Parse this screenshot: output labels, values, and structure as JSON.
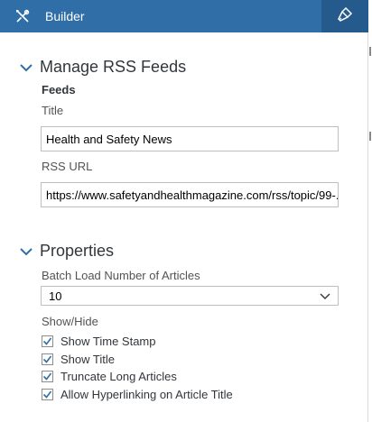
{
  "header": {
    "title": "Builder",
    "tools_icon": "tools-icon",
    "brush_icon": "paintbrush-icon"
  },
  "feeds_section": {
    "title": "Manage RSS Feeds",
    "group_label": "Feeds",
    "title_label": "Title",
    "title_value": "Health and Safety News",
    "url_label": "RSS URL",
    "url_value": "https://www.safetyandhealthmagazine.com/rss/topic/99-..."
  },
  "properties_section": {
    "title": "Properties",
    "batch_label": "Batch Load Number of Articles",
    "batch_value": "10",
    "showhide_label": "Show/Hide",
    "options": [
      {
        "label": "Show Time Stamp",
        "checked": true
      },
      {
        "label": "Show Title",
        "checked": true
      },
      {
        "label": "Truncate Long Articles",
        "checked": true
      },
      {
        "label": "Allow Hyperlinking on Article Title",
        "checked": true
      }
    ]
  },
  "colors": {
    "header_bg": "#2f6ea7",
    "accent": "#2f6ea7"
  }
}
